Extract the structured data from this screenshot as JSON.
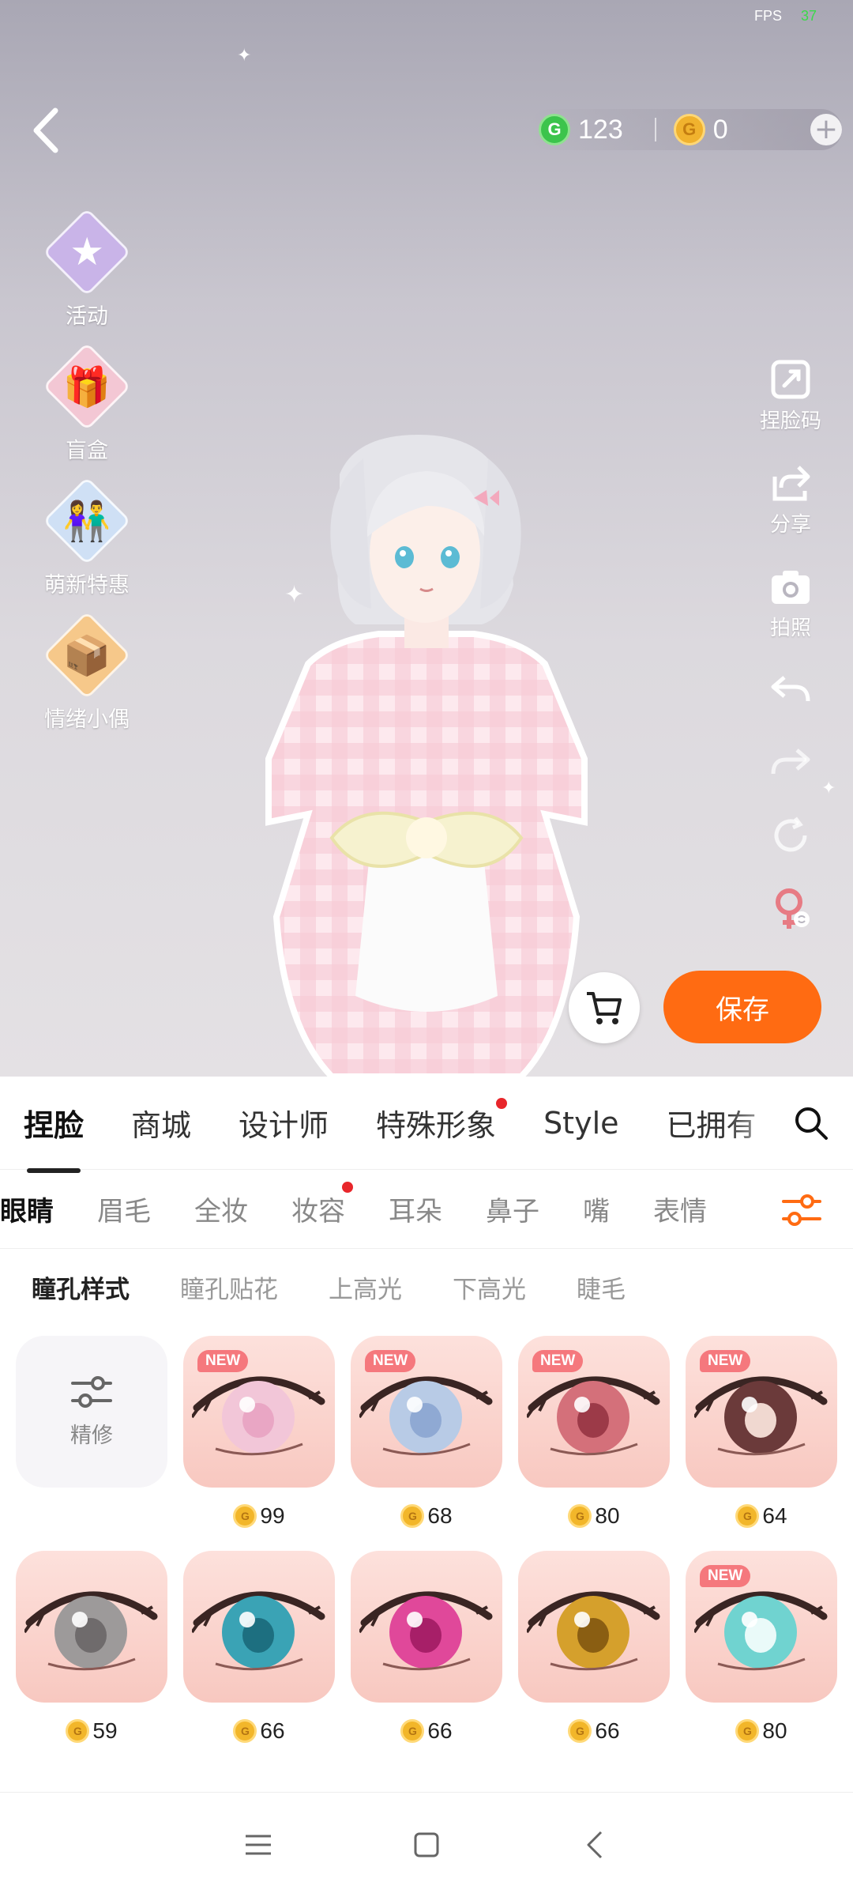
{
  "status": {
    "fps_label": "FPS",
    "fps_value": "37"
  },
  "currency": {
    "green_symbol": "G",
    "green_amount": "123",
    "gold_symbol": "G",
    "gold_amount": "0",
    "add_symbol": "+"
  },
  "left_menu": [
    {
      "label": "活动",
      "icon": "star-badge-icon",
      "glyph": "★",
      "color": "#c9b4e8"
    },
    {
      "label": "盲盒",
      "icon": "gift-box-icon",
      "glyph": "🎁",
      "color": "#f3c7d4"
    },
    {
      "label": "萌新特惠",
      "icon": "couple-avatar-icon",
      "glyph": "👫",
      "color": "#cfe0f5"
    },
    {
      "label": "情绪小偶",
      "icon": "doll-box-icon",
      "glyph": "📦",
      "color": "#f6c88a"
    }
  ],
  "right_menu": [
    {
      "label": "捏脸码",
      "icon": "face-code-icon"
    },
    {
      "label": "分享",
      "icon": "share-icon"
    },
    {
      "label": "拍照",
      "icon": "camera-icon"
    },
    {
      "label": "",
      "icon": "undo-icon"
    },
    {
      "label": "",
      "icon": "redo-icon"
    },
    {
      "label": "",
      "icon": "reset-icon"
    },
    {
      "label": "",
      "icon": "gender-switch-icon"
    }
  ],
  "actions": {
    "save_label": "保存"
  },
  "main_tabs": [
    {
      "label": "捏脸",
      "active": true,
      "dot": false
    },
    {
      "label": "商城",
      "active": false,
      "dot": false
    },
    {
      "label": "设计师",
      "active": false,
      "dot": false
    },
    {
      "label": "特殊形象",
      "active": false,
      "dot": true
    },
    {
      "label": "Style",
      "active": false,
      "dot": false
    },
    {
      "label": "已拥有",
      "active": false,
      "dot": false
    }
  ],
  "sub_tabs": [
    {
      "label": "眼睛",
      "active": true,
      "dot": false
    },
    {
      "label": "眉毛",
      "active": false,
      "dot": false
    },
    {
      "label": "全妆",
      "active": false,
      "dot": false
    },
    {
      "label": "妆容",
      "active": false,
      "dot": true
    },
    {
      "label": "耳朵",
      "active": false,
      "dot": false
    },
    {
      "label": "鼻子",
      "active": false,
      "dot": false
    },
    {
      "label": "嘴",
      "active": false,
      "dot": false
    },
    {
      "label": "表情",
      "active": false,
      "dot": false
    }
  ],
  "third_tabs": [
    {
      "label": "瞳孔样式",
      "active": true
    },
    {
      "label": "瞳孔贴花",
      "active": false
    },
    {
      "label": "上高光",
      "active": false
    },
    {
      "label": "下高光",
      "active": false
    },
    {
      "label": "睫毛",
      "active": false
    }
  ],
  "refine": {
    "label": "精修"
  },
  "items": [
    {
      "new": true,
      "price": "99",
      "iris": "#f2c6d8",
      "pupil": "#e9a6c4"
    },
    {
      "new": true,
      "price": "68",
      "iris": "#b8cbe6",
      "pupil": "#8fa9d3"
    },
    {
      "new": true,
      "price": "80",
      "iris": "#d4707a",
      "pupil": "#9c3a48"
    },
    {
      "new": true,
      "price": "64",
      "iris": "#6b3a3a",
      "pupil": "#f0d8d0"
    },
    {
      "new": false,
      "price": "59",
      "iris": "#9d9a9a",
      "pupil": "#6f6b6c"
    },
    {
      "new": false,
      "price": "66",
      "iris": "#3aa3b5",
      "pupil": "#1d6f80"
    },
    {
      "new": false,
      "price": "66",
      "iris": "#e0489a",
      "pupil": "#a71f68"
    },
    {
      "new": false,
      "price": "66",
      "iris": "#d5a02c",
      "pupil": "#8a5e12"
    },
    {
      "new": true,
      "price": "80",
      "iris": "#70d3d0",
      "pupil": "#eafaf9"
    }
  ],
  "badge_text": "NEW",
  "coin_symbol": "G"
}
